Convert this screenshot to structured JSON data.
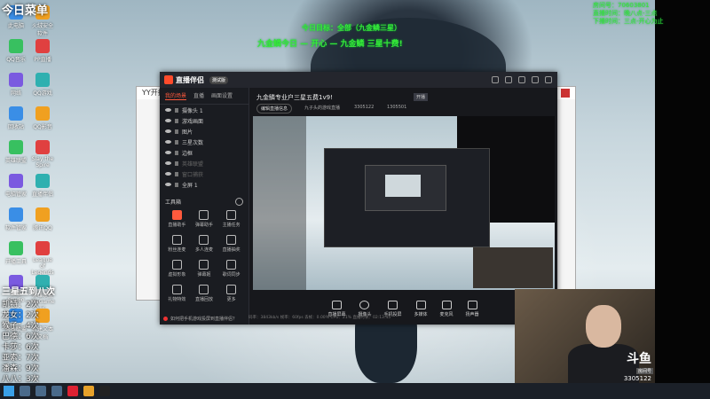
{
  "overlay": {
    "top_left_title": "今日菜单",
    "top_center_line1": "今日目标：全部（九金鳞三星）",
    "top_center_line2": "九金鳞今日 — 开心 — 九金鳞 三星十费!",
    "top_right_line1": "房间号：70603801",
    "top_right_line2": "直播时间：晚八点-三点",
    "top_right_line3": "下播时间：三点-开心为止",
    "list_header": "三星五到八次",
    "list_items": [
      "凯特：2次",
      "龙女：2次",
      "猴子：4次",
      "巴德：6次",
      "卡莎：6次",
      "亚索：7次",
      "潘森：9次",
      "八八：3次"
    ]
  },
  "desktop_icons": [
    {
      "label": "此电脑"
    },
    {
      "label": "火绒安全软件"
    },
    {
      "label": "QQ音乐"
    },
    {
      "label": "PP直播"
    },
    {
      "label": "网络"
    },
    {
      "label": "QQ游戏"
    },
    {
      "label": "回收站"
    },
    {
      "label": "QQ影音"
    },
    {
      "label": "英雄联盟"
    },
    {
      "label": "Slay the Spire"
    },
    {
      "label": "电脑管家"
    },
    {
      "label": "直播伴侣"
    },
    {
      "label": "软件管家"
    },
    {
      "label": "腾讯QQ"
    },
    {
      "label": "开播工具"
    },
    {
      "label": "League of Legends"
    },
    {
      "label": "OBS Studio"
    },
    {
      "label": "英雄联盟WeGame版"
    },
    {
      "label": "英雄联盟"
    },
    {
      "label": "新建文本文档"
    }
  ],
  "yy_window": {
    "title": "YY开播"
  },
  "app": {
    "brand": "直播伴侣",
    "beta": "测试版",
    "left_tabs": [
      "我的场景",
      "直播",
      "画面设置"
    ],
    "scenes": [
      {
        "name": "摄像头 1",
        "dim": false
      },
      {
        "name": "游戏画面",
        "dim": false
      },
      {
        "name": "图片",
        "dim": false
      },
      {
        "name": "三星次数",
        "dim": false
      },
      {
        "name": "边框",
        "dim": false
      },
      {
        "name": "英雄联盟",
        "dim": true
      },
      {
        "name": "窗口捕获",
        "dim": true
      },
      {
        "name": "全屏 1",
        "dim": false
      }
    ],
    "tools_title": "工具箱",
    "tools": [
      "直播助手",
      "弹幕助手",
      "主播任务",
      "粉丝连麦",
      "多人连麦",
      "直播抽奖",
      "虚拟形象",
      "弹幕姬",
      "歌词同步",
      "礼物特效",
      "直播回放",
      "更多"
    ],
    "notice": "如何把手机游戏投屏到直播伴侣？",
    "channel_title": "九金鳞专业户三星五费1v9!",
    "channel_tag": "开播",
    "channel_btn": "编辑直播信息",
    "channel_info": "九子头的游戏直播",
    "channel_num1": "3305122",
    "channel_num2": "1305501",
    "bottom_tools": [
      "直播屏幕",
      "摄像头",
      "手机投屏",
      "多媒体",
      "麦克风",
      "扬声器"
    ],
    "status_line": "码率：3843kb/s    帧率：60fps    丢帧：0.00%    CPU：21%    直播时长：02:13:45"
  },
  "webcam": {
    "logo": "斗鱼",
    "sub": "房间号",
    "room": "3305122"
  }
}
